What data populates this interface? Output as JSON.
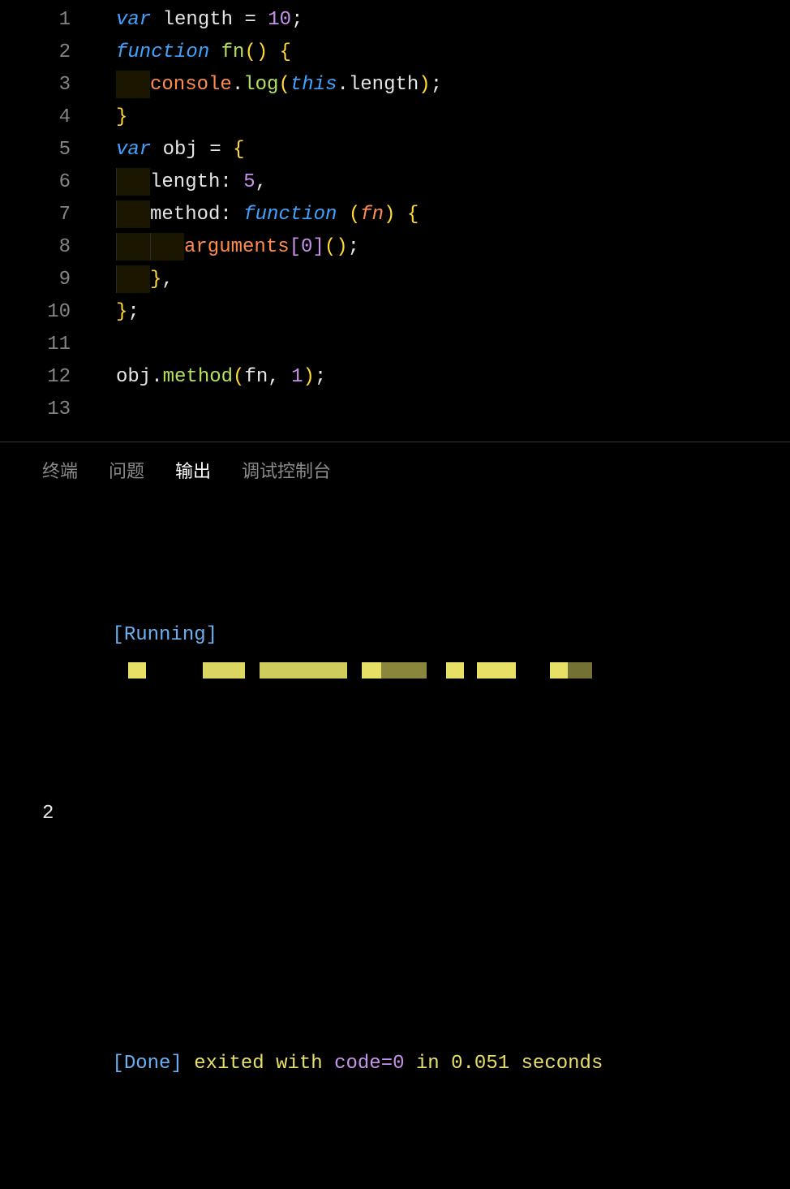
{
  "editor": {
    "lines": [
      1,
      2,
      3,
      4,
      5,
      6,
      7,
      8,
      9,
      10,
      11,
      12,
      13
    ],
    "code": {
      "l1": {
        "kw": "var",
        "id": "length",
        "eq": " = ",
        "num": "10",
        "semi": ";"
      },
      "l2": {
        "kw": "function",
        "fn": "fn",
        "parens": "()",
        "brace": " {"
      },
      "l3": {
        "obj": "console",
        "dot1": ".",
        "meth": "log",
        "open": "(",
        "this": "this",
        "dot2": ".",
        "prop": "length",
        "close": ")",
        "semi": ";"
      },
      "l4": {
        "brace": "}"
      },
      "l5": {
        "kw": "var",
        "id": "obj",
        "eq": " = ",
        "brace": "{"
      },
      "l6": {
        "prop": "length",
        "colon": ": ",
        "num": "5",
        "comma": ","
      },
      "l7": {
        "prop": "method",
        "colon": ": ",
        "kw": "function",
        "sp": " ",
        "open": "(",
        "param": "fn",
        "close": ")",
        "brace": " {"
      },
      "l8": {
        "obj": "arguments",
        "open": "[",
        "num": "0",
        "close": "]",
        "call": "()",
        "semi": ";"
      },
      "l9": {
        "brace": "}",
        "comma": ","
      },
      "l10": {
        "brace": "}",
        "semi": ";"
      },
      "l12": {
        "obj": "obj",
        "dot": ".",
        "meth": "method",
        "open": "(",
        "a1": "fn",
        "comma": ", ",
        "a2": "1",
        "close": ")",
        "semi": ";"
      }
    }
  },
  "panel": {
    "tabs": {
      "terminal": "终端",
      "problems": "问题",
      "output": "输出",
      "debug": "调试控制台"
    },
    "output": {
      "running": "[Running]",
      "result": "2",
      "done": "[Done]",
      "exited": " exited with ",
      "code": "code=0",
      "in": " in ",
      "time": "0.051",
      "seconds": " seconds"
    }
  }
}
